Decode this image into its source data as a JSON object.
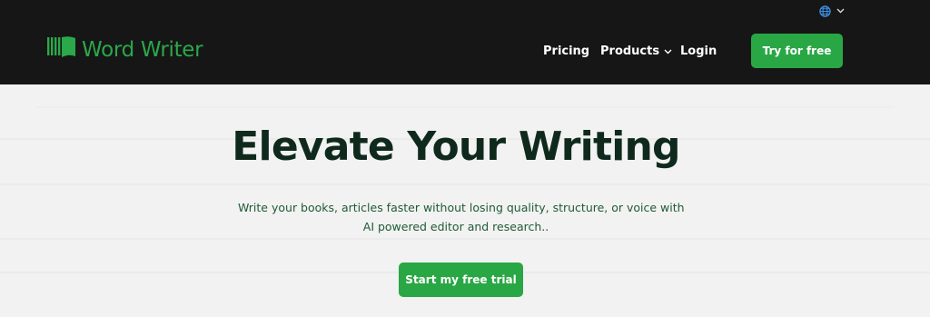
{
  "header": {
    "background": "#161616",
    "language_icon": "globe-icon",
    "brand": {
      "name": "Word Writer",
      "icon": "book-pages-icon",
      "color": "#2ba84a"
    },
    "nav": {
      "pricing": "Pricing",
      "products": "Products",
      "login": "Login"
    },
    "cta": "Try for free"
  },
  "hero": {
    "title": "Elevate Your Writing",
    "subtitle_line1": "Write your books, articles faster without losing quality, structure, or voice with",
    "subtitle_line2": "AI powered editor and research..",
    "cta": "Start my free trial"
  },
  "colors": {
    "accent": "#29a745",
    "title": "#0f2a1d",
    "subtitle": "#1f5a36",
    "page_bg": "#f2f2f2"
  }
}
